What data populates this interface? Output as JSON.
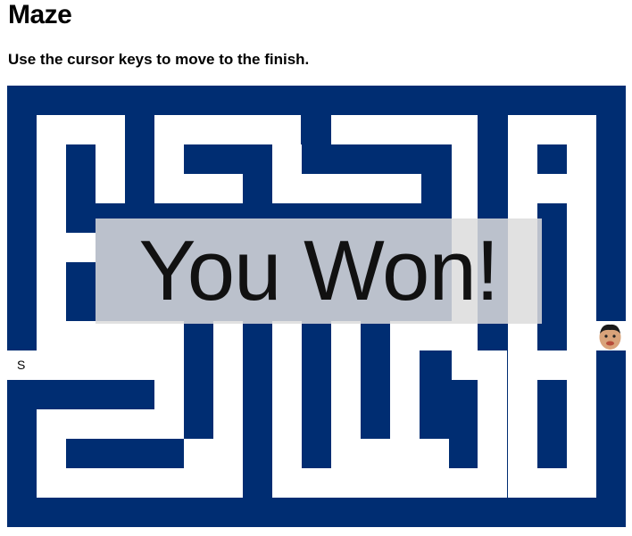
{
  "page": {
    "title": "Maze",
    "instructions": "Use the cursor keys to move to the finish."
  },
  "maze": {
    "wall_color": "#002d72",
    "path_color": "#ffffff",
    "start_label": "S",
    "player_icon": "player-face-icon"
  },
  "overlay": {
    "message": "You Won!"
  }
}
